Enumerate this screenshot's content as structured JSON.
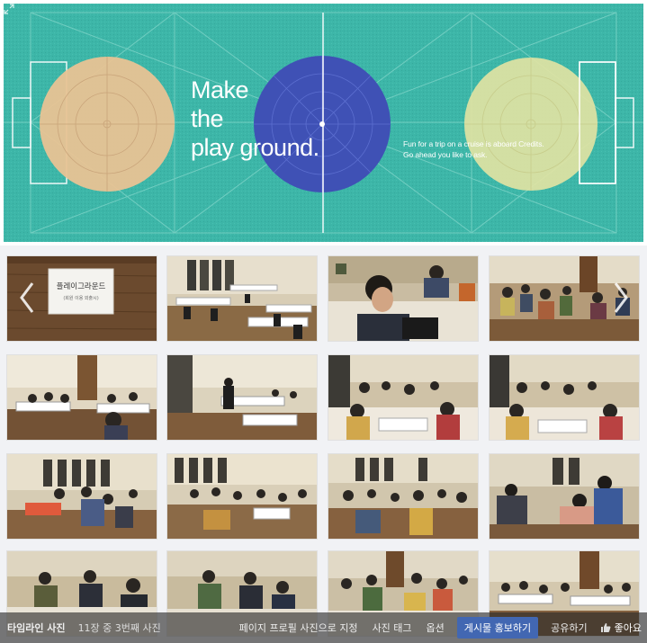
{
  "cover": {
    "headline": [
      "Make",
      "the",
      "play ground."
    ],
    "subtext": [
      "Fun for a trip on a cruise is aboard Credits.",
      "Go ahead you like to ask."
    ],
    "colors": {
      "field": "#3db6a8",
      "left_circle": "#e8c393",
      "center_circle": "#3f51b5",
      "right_circle": "#dfe3a3"
    },
    "expand_icon": "expand-icon"
  },
  "photos": {
    "sign_line1": "플레이그라운드",
    "sign_line2": "(회원 이용 외출시)",
    "prev_icon": "chevron-left-icon",
    "next_icon": "chevron-right-icon",
    "count": 16
  },
  "toolbar": {
    "album": "타임라인 사진",
    "count": "11장 중 3번째 사진",
    "set_profile": "페이지 프로필 사진으로 지정",
    "tag": "사진 태그",
    "options": "옵션",
    "boost": "게시물 홍보하기",
    "share": "공유하기",
    "like": "좋아요",
    "like_icon": "thumbs-up-icon"
  }
}
